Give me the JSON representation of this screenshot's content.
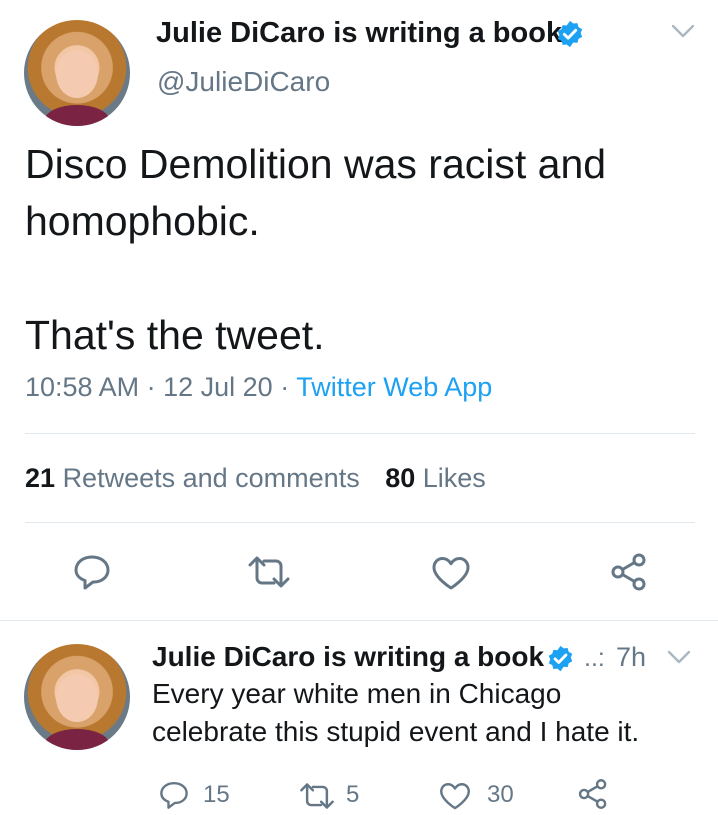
{
  "main_tweet": {
    "display_name": "Julie DiCaro is writing a book",
    "handle": "@JulieDiCaro",
    "text_line1": "Disco Demolition was racist and",
    "text_line2": "homophobic.",
    "text_line3": "That's the tweet.",
    "time": "10:58 AM",
    "sep1": "·",
    "date": "12 Jul 20",
    "sep2": "·",
    "source": "Twitter Web App",
    "retweets_count": "21",
    "retweets_label": "Retweets and comments",
    "likes_count": "80",
    "likes_label": "Likes",
    "icons": [
      "reply-icon",
      "retweet-icon",
      "like-icon",
      "share-icon",
      "verified-icon",
      "chevron-down-icon"
    ]
  },
  "reply_tweet": {
    "display_name": "Julie DiCaro is writing a book",
    "ellipsis": "..:",
    "time_ago": "7h",
    "text_line1": "Every year white men in Chicago",
    "text_line2": "celebrate this stupid event and I hate it.",
    "reply_count": "15",
    "retweet_count": "5",
    "like_count": "30"
  },
  "colors": {
    "accent": "#1da1f2",
    "secondary_text": "#657786",
    "primary_text": "#14171a",
    "divider": "#e1e8ed"
  }
}
